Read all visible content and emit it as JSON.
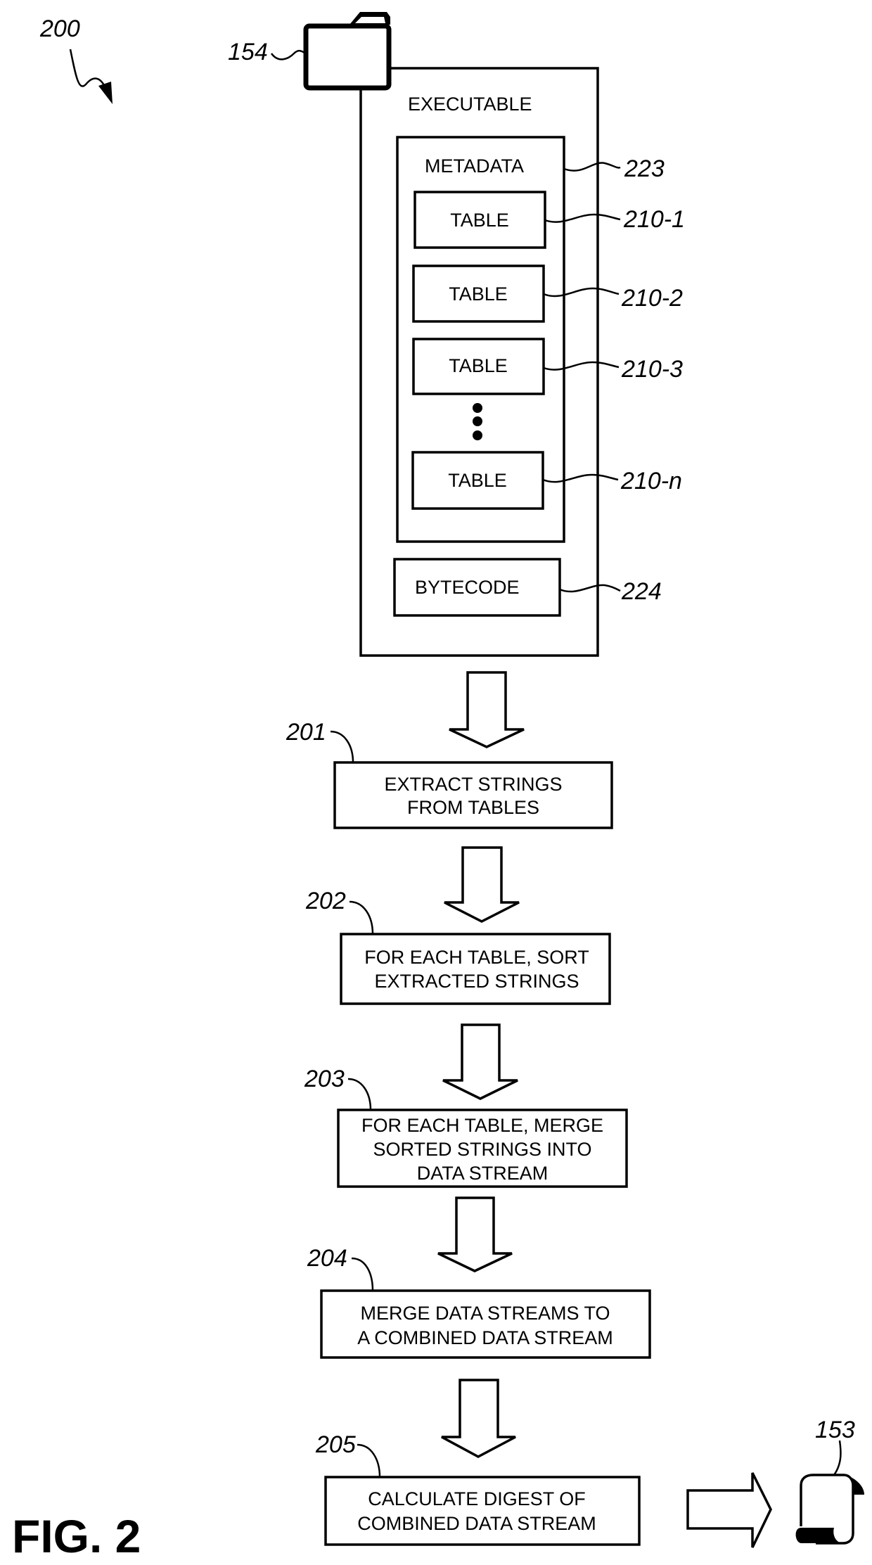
{
  "figure": {
    "title": "FIG. 2",
    "diagram_ref": "200"
  },
  "executable": {
    "ref": "154",
    "label": "EXECUTABLE",
    "metadata": {
      "ref": "223",
      "label": "METADATA",
      "tables": [
        {
          "label": "TABLE",
          "ref": "210-1"
        },
        {
          "label": "TABLE",
          "ref": "210-2"
        },
        {
          "label": "TABLE",
          "ref": "210-3"
        },
        {
          "label": "TABLE",
          "ref": "210-n"
        }
      ]
    },
    "bytecode": {
      "label": "BYTECODE",
      "ref": "224"
    }
  },
  "steps": [
    {
      "ref": "201",
      "lines": [
        "EXTRACT STRINGS",
        "FROM TABLES"
      ]
    },
    {
      "ref": "202",
      "lines": [
        "FOR EACH TABLE, SORT",
        "EXTRACTED STRINGS"
      ]
    },
    {
      "ref": "203",
      "lines": [
        "FOR EACH TABLE, MERGE",
        "SORTED STRINGS INTO",
        "DATA STREAM"
      ]
    },
    {
      "ref": "204",
      "lines": [
        "MERGE  DATA STREAMS TO",
        "A COMBINED DATA STREAM"
      ]
    },
    {
      "ref": "205",
      "lines": [
        "CALCULATE DIGEST OF",
        "COMBINED DATA STREAM"
      ]
    }
  ],
  "output": {
    "ref": "153",
    "icon": "scroll-document-icon"
  }
}
